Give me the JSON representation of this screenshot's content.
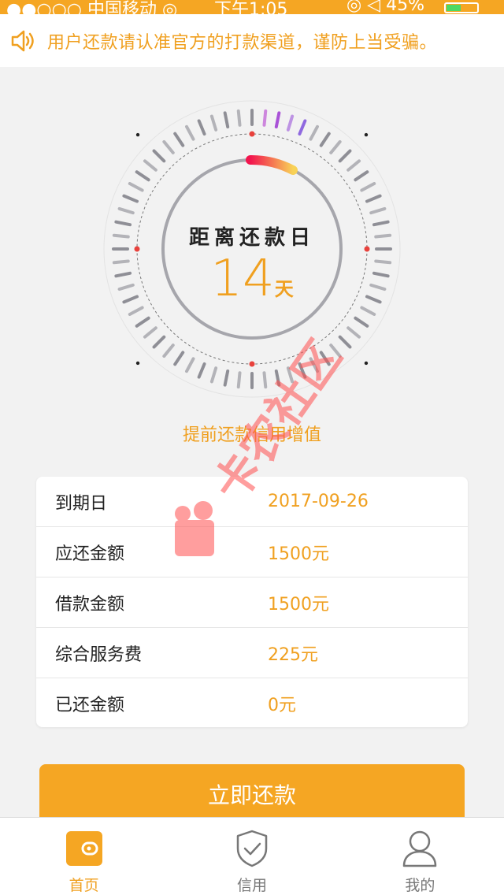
{
  "status_bar": {
    "left": "●●○○○ 中国移动 ◎",
    "time": "下午1:05",
    "right": "◎ ◁ 45%",
    "battery_level": 0.45
  },
  "notice": {
    "icon": "speaker-icon",
    "text": "用户还款请认准官方的打款渠道，谨防上当受骗。"
  },
  "countdown": {
    "title": "距离还款日",
    "days": "14",
    "unit": "天"
  },
  "hint": "提前还款信用增值",
  "details": [
    {
      "label": "到期日",
      "value": "2017-09-26"
    },
    {
      "label": "应还金额",
      "value": "1500元"
    },
    {
      "label": "借款金额",
      "value": "1500元"
    },
    {
      "label": "综合服务费",
      "value": "225元"
    },
    {
      "label": "已还金额",
      "value": "0元"
    }
  ],
  "pay_button": "立即还款",
  "tabs": [
    {
      "label": "首页",
      "icon": "wallet-icon",
      "active": true
    },
    {
      "label": "信用",
      "icon": "shield-check-icon",
      "active": false
    },
    {
      "label": "我的",
      "icon": "user-icon",
      "active": false
    }
  ],
  "watermark": "卡农社区",
  "colors": {
    "accent": "#f5a623",
    "accent_text": "#f0a020",
    "watermark": "#ff5050"
  }
}
